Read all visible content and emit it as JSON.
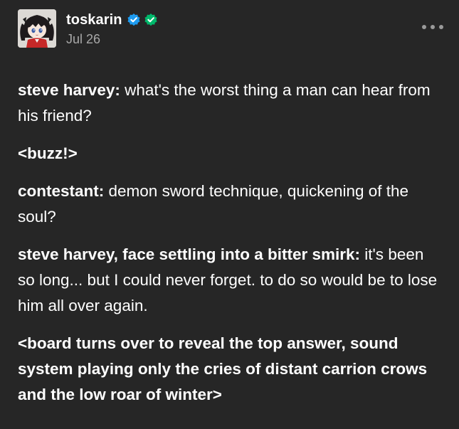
{
  "post": {
    "username": "toskarin",
    "date": "Jul 26",
    "icons": {
      "verified": "verified-badge-icon",
      "check": "check-badge-icon",
      "more": "more-options-icon"
    },
    "colors": {
      "background": "#262626",
      "verified_blue": "#1d9bf0",
      "check_green": "#00b86b",
      "date_gray": "#a8a8a8"
    },
    "paragraphs": [
      {
        "speaker": "steve harvey",
        "sep": ": ",
        "text": "what's the worst thing a man can hear from his friend?"
      },
      {
        "bold_text": "<buzz!>"
      },
      {
        "speaker": "contestant",
        "sep": ": ",
        "text": "demon sword technique, quickening of the soul?"
      },
      {
        "speaker": "steve harvey, face settling into a bitter smirk",
        "sep": ": ",
        "text": "it's been so long... but I could never forget. to do so would be to lose him all over again."
      },
      {
        "bold_text": "<board turns over to reveal the top answer, sound system playing only the cries of distant carrion crows and the low roar of winter>"
      }
    ]
  }
}
